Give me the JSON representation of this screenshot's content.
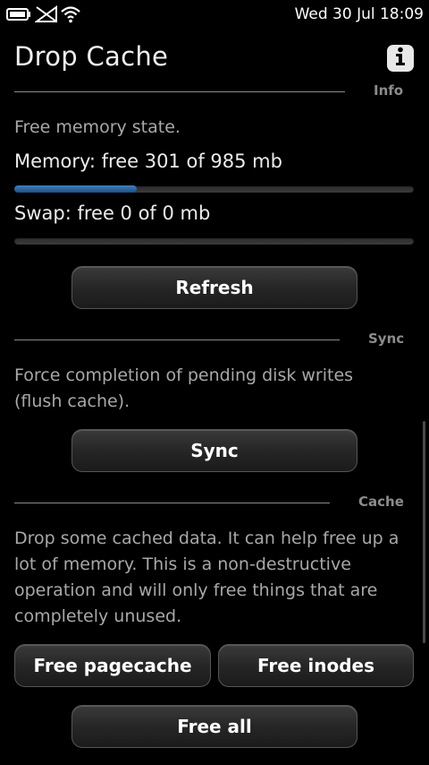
{
  "status_bar": {
    "clock": "Wed 30 Jul 18:09",
    "icons": [
      "battery-icon",
      "no-signal-icon",
      "wifi-icon"
    ]
  },
  "header": {
    "title": "Drop Cache",
    "info_icon": "info-icon"
  },
  "info_section": {
    "label": "Info",
    "description": "Free memory state.",
    "memory_text": "Memory: free 301 of 985 mb",
    "memory_free": 301,
    "memory_total": 985,
    "swap_text": "Swap: free 0 of 0 mb",
    "swap_free": 0,
    "swap_total": 0,
    "refresh_label": "Refresh"
  },
  "sync_section": {
    "label": "Sync",
    "description_line1": "Force completion of pending disk writes",
    "description_line2": "(flush cache).",
    "sync_label": "Sync"
  },
  "cache_section": {
    "label": "Cache",
    "description_line1": "Drop some cached data. It can help free up a",
    "description_line2": "lot of memory. This is a non-destructive",
    "description_line3": "operation and will only free things that are",
    "description_line4": "completely unused.",
    "free_pagecache_label": "Free pagecache",
    "free_inodes_label": "Free inodes",
    "free_all_label": "Free all"
  },
  "colors": {
    "background": "#000000",
    "progress_fill": "#2f6aa6",
    "section_line": "#8a8a8a"
  }
}
